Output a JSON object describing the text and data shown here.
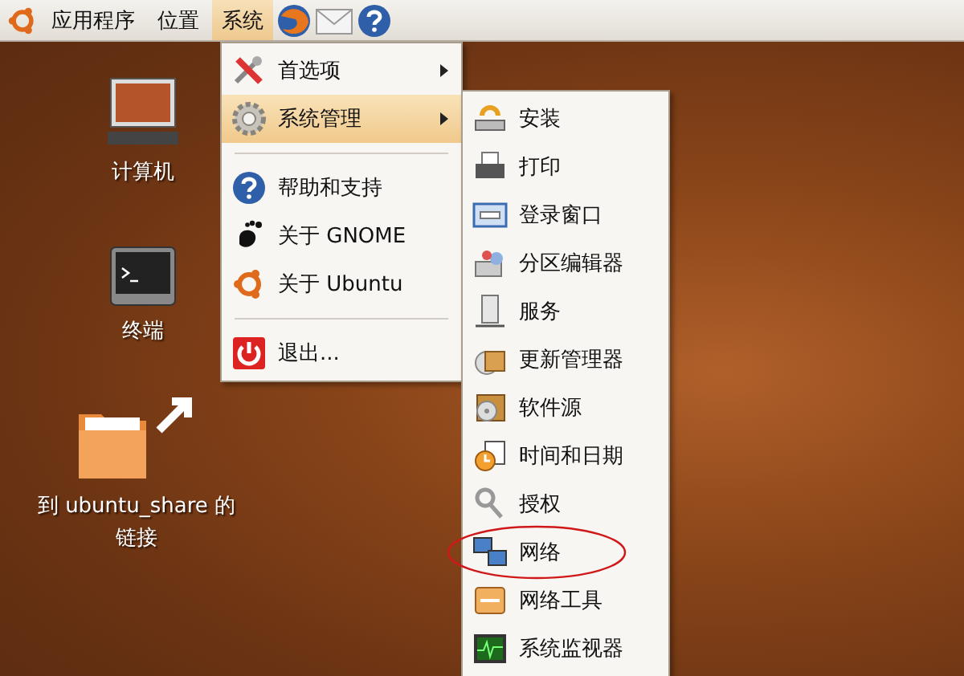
{
  "top_panel": {
    "menus": [
      {
        "label": "应用程序",
        "selected": false
      },
      {
        "label": "位置",
        "selected": false
      },
      {
        "label": "系统",
        "selected": true
      }
    ]
  },
  "desktop_icons": [
    {
      "kind": "computer",
      "label": "计算机"
    },
    {
      "kind": "terminal",
      "label": "终端"
    },
    {
      "kind": "folder-link",
      "label": "到 ubuntu_share 的",
      "label_line_2": "链接"
    }
  ],
  "system_menu": {
    "items": [
      {
        "kind": "item",
        "label": "首选项",
        "has_submenu": true,
        "selected": false
      },
      {
        "kind": "item",
        "label": "系统管理",
        "has_submenu": true,
        "selected": true
      },
      {
        "kind": "separator"
      },
      {
        "kind": "item",
        "label": "帮助和支持",
        "has_submenu": false,
        "selected": false
      },
      {
        "kind": "item",
        "label": "关于 GNOME",
        "has_submenu": false,
        "selected": false
      },
      {
        "kind": "item",
        "label": "关于 Ubuntu",
        "has_submenu": false,
        "selected": false
      },
      {
        "kind": "separator"
      },
      {
        "kind": "item",
        "label": "退出...",
        "has_submenu": false,
        "selected": false
      }
    ]
  },
  "admin_submenu": {
    "items": [
      {
        "label": "安装",
        "circled": false
      },
      {
        "label": "打印",
        "circled": false
      },
      {
        "label": "登录窗口",
        "circled": false
      },
      {
        "label": "分区编辑器",
        "circled": false
      },
      {
        "label": "服务",
        "circled": false
      },
      {
        "label": "更新管理器",
        "circled": false
      },
      {
        "label": "软件源",
        "circled": false
      },
      {
        "label": "时间和日期",
        "circled": false
      },
      {
        "label": "授权",
        "circled": false
      },
      {
        "label": "网络",
        "circled": true
      },
      {
        "label": "网络工具",
        "circled": false
      },
      {
        "label": "系统监视器",
        "circled": false
      }
    ]
  }
}
